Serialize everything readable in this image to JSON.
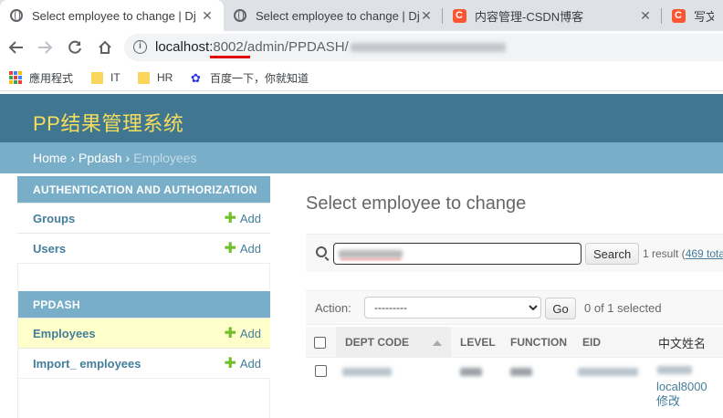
{
  "browser": {
    "tabs": [
      {
        "title": "Select employee to change | Dj",
        "icon": "globe-icon",
        "active": true
      },
      {
        "title": "Select employee to change | Dj",
        "icon": "globe-icon",
        "active": false
      },
      {
        "title": "内容管理-CSDN博客",
        "icon": "csdn-icon",
        "active": false
      },
      {
        "title": "写文章",
        "icon": "csdn-icon",
        "active": false
      }
    ],
    "close_glyph": "✕",
    "csdn_letter": "C",
    "url": {
      "host": "localhost:",
      "port": "8002",
      "path": "/admin/PPDASH/"
    },
    "bookmarks": [
      {
        "label": "應用程式",
        "icon": "apps-grid-icon"
      },
      {
        "label": "IT",
        "icon": "folder-icon"
      },
      {
        "label": "HR",
        "icon": "folder-icon"
      },
      {
        "label": "百度一下，你就知道",
        "icon": "baidu-paw-icon"
      }
    ],
    "underline_color": "#e00000"
  },
  "admin": {
    "branding": "PP结果管理系统",
    "breadcrumbs": {
      "home": "Home",
      "app": "Ppdash",
      "current": "Employees",
      "sep": "›"
    },
    "colors": {
      "header": "#417690",
      "brand_text": "#f5dd5d",
      "caption": "#79aec8",
      "link": "#447e9b",
      "add_plus": "#70bf2b",
      "current_row": "#ffffcc"
    },
    "sidebar": {
      "modules": [
        {
          "caption": "AUTHENTICATION AND AUTHORIZATION",
          "models": [
            {
              "name": "Groups",
              "add": "Add"
            },
            {
              "name": "Users",
              "add": "Add"
            }
          ]
        },
        {
          "caption": "PPDASH",
          "models": [
            {
              "name": "Employees",
              "add": "Add",
              "current": true
            },
            {
              "name": "Import_ employees",
              "add": "Add"
            }
          ]
        }
      ],
      "plus_glyph": "✚"
    },
    "content": {
      "title": "Select employee to change",
      "search": {
        "button": "Search",
        "result_count": "1 result (",
        "total_link": "469 tota"
      },
      "actions": {
        "label": "Action:",
        "selected_option": "---------",
        "go": "Go",
        "selection": "0 of 1 selected"
      },
      "table": {
        "headers": [
          "DEPT CODE",
          "LEVEL",
          "FUNCTION",
          "EID",
          "中文姓名"
        ],
        "row": {
          "name_line1": "local8000",
          "name_line2": "修改"
        }
      }
    }
  }
}
